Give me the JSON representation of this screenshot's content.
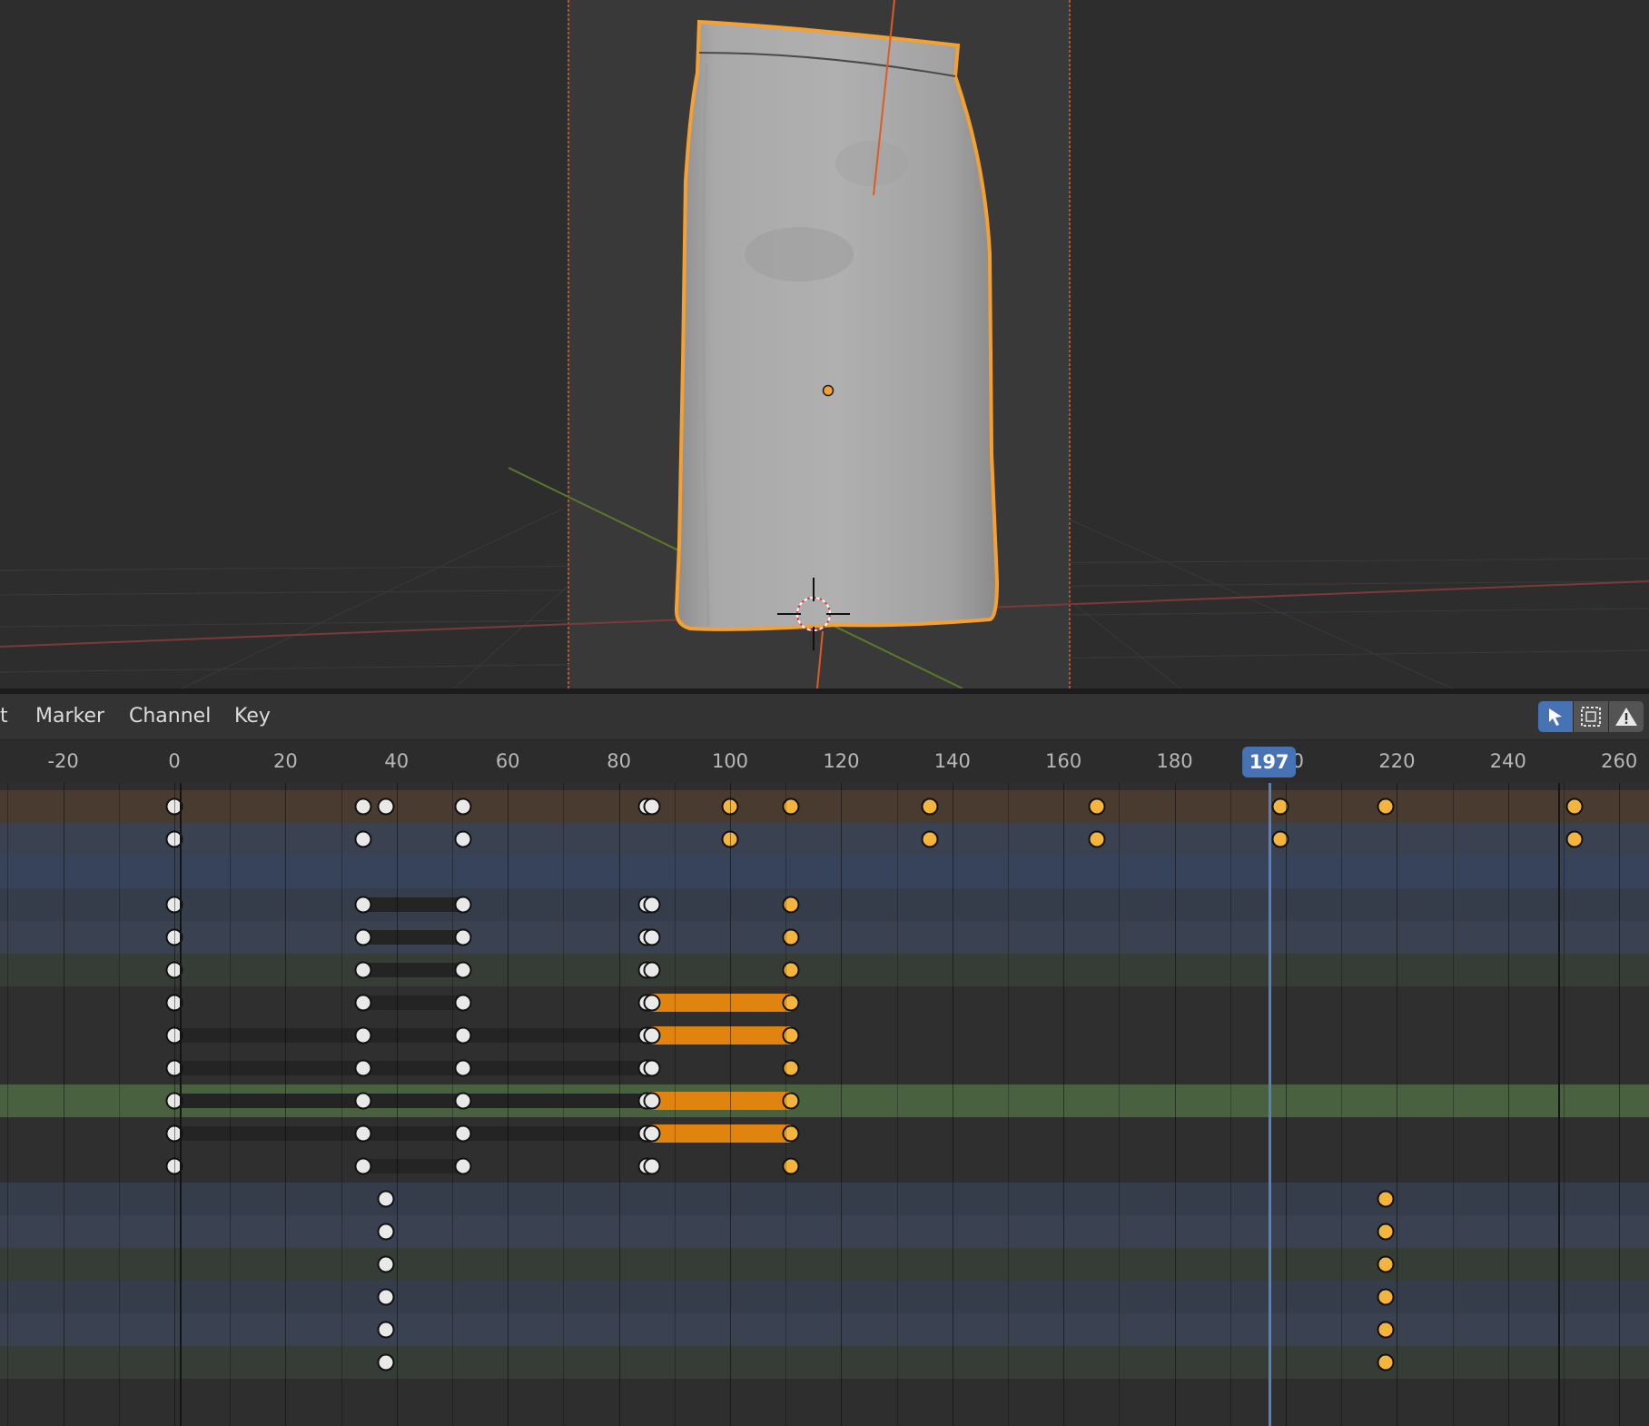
{
  "header": {
    "menus": [
      "t",
      "Marker",
      "Channel",
      "Key"
    ],
    "tools": [
      "select-tool-icon",
      "box-select-icon",
      "warning-icon"
    ]
  },
  "timeline": {
    "ticks": [
      "-20",
      "0",
      "20",
      "40",
      "60",
      "80",
      "100",
      "120",
      "140",
      "160",
      "180",
      "200",
      "220",
      "240",
      "260"
    ],
    "tick_values": [
      -20,
      0,
      20,
      40,
      60,
      80,
      100,
      120,
      140,
      160,
      180,
      200,
      220,
      240,
      260
    ],
    "current_frame": "197",
    "current_frame_value": 197,
    "scene_start": 0,
    "scene_end": 249
  },
  "channels": [
    {
      "kind": "summary",
      "keys_unsel": [
        0,
        34,
        38,
        52,
        85,
        86
      ],
      "keys_sel": [
        100,
        111,
        136,
        166,
        199,
        218,
        252
      ],
      "holds": []
    },
    {
      "kind": "object",
      "keys_unsel": [
        0,
        34,
        52
      ],
      "keys_sel": [
        100,
        136,
        166,
        199,
        252
      ],
      "holds": []
    },
    {
      "kind": "group",
      "keys_unsel": [],
      "keys_sel": [],
      "holds": []
    },
    {
      "kind": "fcurve-x",
      "keys_unsel": [
        0,
        34,
        52,
        85,
        86
      ],
      "keys_sel": [
        111
      ],
      "holds": [
        [
          34,
          52,
          0
        ]
      ]
    },
    {
      "kind": "fcurve-y",
      "keys_unsel": [
        0,
        34,
        52,
        85,
        86
      ],
      "keys_sel": [
        111
      ],
      "holds": [
        [
          34,
          52,
          0
        ]
      ]
    },
    {
      "kind": "fcurve-z",
      "keys_unsel": [
        0,
        34,
        52,
        85,
        86
      ],
      "keys_sel": [
        111
      ],
      "holds": [
        [
          34,
          52,
          0
        ]
      ]
    },
    {
      "kind": "plain",
      "keys_unsel": [
        0,
        34,
        52,
        85,
        86
      ],
      "keys_sel": [
        111
      ],
      "holds": [
        [
          34,
          52,
          0
        ],
        [
          86,
          111,
          1
        ]
      ]
    },
    {
      "kind": "plain",
      "keys_unsel": [
        0,
        34,
        52,
        85,
        86
      ],
      "keys_sel": [
        111
      ],
      "holds": [
        [
          0,
          86,
          0
        ],
        [
          86,
          111,
          1
        ]
      ]
    },
    {
      "kind": "plain",
      "keys_unsel": [
        0,
        34,
        52,
        85,
        86
      ],
      "keys_sel": [
        111
      ],
      "holds": [
        [
          0,
          86,
          0
        ]
      ]
    },
    {
      "kind": "active",
      "keys_unsel": [
        0,
        34,
        52,
        85,
        86
      ],
      "keys_sel": [
        111
      ],
      "holds": [
        [
          0,
          86,
          0
        ],
        [
          86,
          111,
          1
        ]
      ]
    },
    {
      "kind": "plain",
      "keys_unsel": [
        0,
        34,
        52,
        85,
        86
      ],
      "keys_sel": [
        111
      ],
      "holds": [
        [
          0,
          86,
          0
        ],
        [
          86,
          111,
          1
        ]
      ]
    },
    {
      "kind": "plain",
      "keys_unsel": [
        0,
        34,
        52,
        85,
        86
      ],
      "keys_sel": [
        111
      ],
      "holds": [
        [
          34,
          52,
          0
        ]
      ]
    },
    {
      "kind": "fcurve-x",
      "keys_unsel": [
        38
      ],
      "keys_sel": [
        218
      ],
      "holds": []
    },
    {
      "kind": "fcurve-y",
      "keys_unsel": [
        38
      ],
      "keys_sel": [
        218
      ],
      "holds": []
    },
    {
      "kind": "fcurve-z",
      "keys_unsel": [
        38
      ],
      "keys_sel": [
        218
      ],
      "holds": []
    },
    {
      "kind": "fcurve-x",
      "keys_unsel": [
        38
      ],
      "keys_sel": [
        218
      ],
      "holds": []
    },
    {
      "kind": "fcurve-y",
      "keys_unsel": [
        38
      ],
      "keys_sel": [
        218
      ],
      "holds": []
    },
    {
      "kind": "fcurve-z",
      "keys_unsel": [
        38
      ],
      "keys_sel": [
        218
      ],
      "holds": []
    }
  ],
  "colors": {
    "summary": "#4a3b31",
    "object": "#3a4150",
    "group": "#36435a",
    "fcurve-x": "#353d4b",
    "fcurve-y": "#3a4150",
    "fcurve-z": "#363d36",
    "plain": "#2f2f2f",
    "active": "#4a6140",
    "accent": "#4772b3",
    "selected_key": "#f5b53c",
    "selected_outline": "#f5a132"
  }
}
